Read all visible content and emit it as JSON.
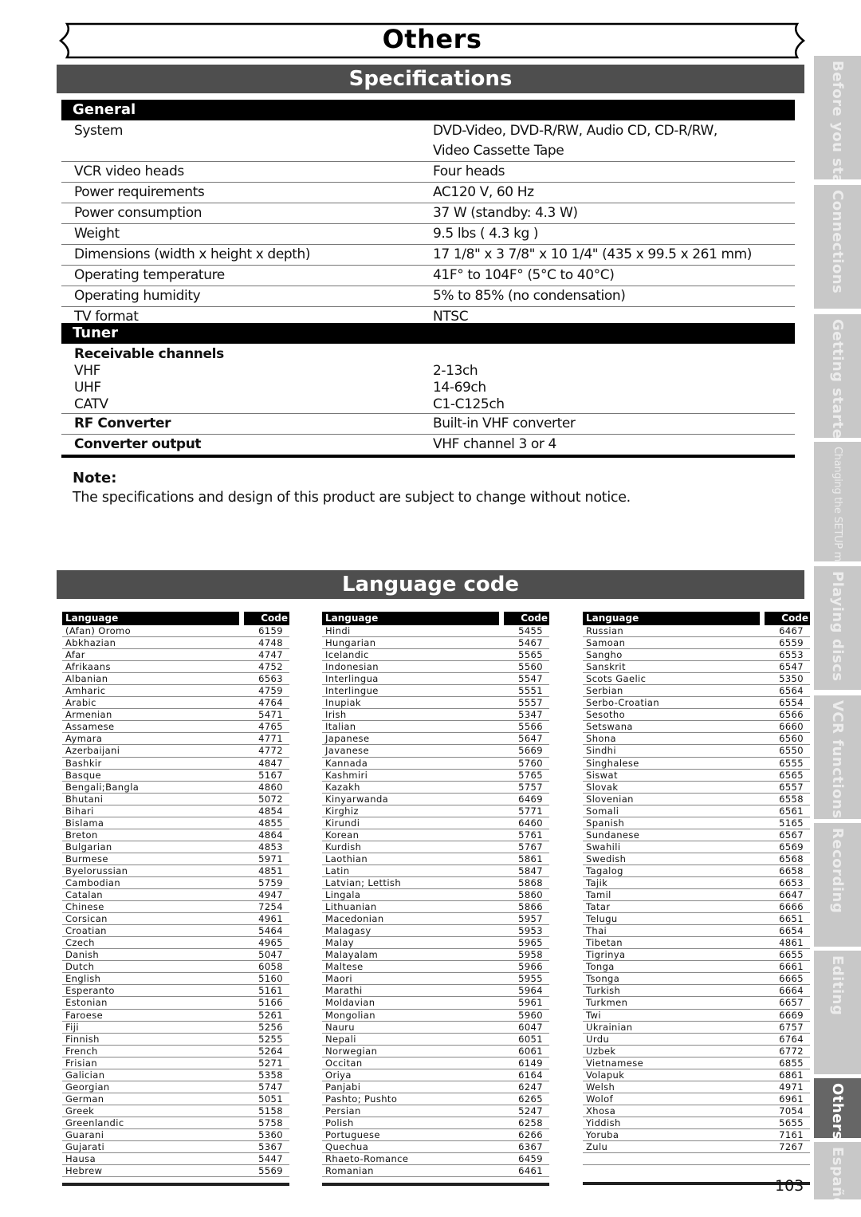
{
  "header": {
    "title": "Others"
  },
  "specifications": {
    "title": "Specifications",
    "general": {
      "title": "General",
      "rows": [
        {
          "label": "System",
          "value": "DVD-Video, DVD-R/RW,  Audio CD, CD-R/RW,",
          "value2": "Video Cassette Tape"
        },
        {
          "label": "VCR video heads",
          "value": "Four heads"
        },
        {
          "label": "Power requirements",
          "value": "AC120 V, 60 Hz"
        },
        {
          "label": "Power consumption",
          "value": "37 W (standby: 4.3 W)"
        },
        {
          "label": "Weight",
          "value": "9.5 lbs ( 4.3 kg )"
        },
        {
          "label": "Dimensions (width x height x depth)",
          "value": "17 1/8\" x 3 7/8\" x 10 1/4\" (435 x 99.5 x 261 mm)"
        },
        {
          "label": "Operating temperature",
          "value": "41F° to 104F° (5°C to 40°C)"
        },
        {
          "label": "Operating humidity",
          "value": "5% to 85% (no condensation)"
        },
        {
          "label": "TV format",
          "value": "NTSC"
        }
      ]
    },
    "tuner": {
      "title": "Tuner",
      "receivable_label": "Receivable channels",
      "channels": [
        {
          "label": "VHF",
          "value": "2-13ch"
        },
        {
          "label": "UHF",
          "value": "14-69ch"
        },
        {
          "label": "CATV",
          "value": "C1-C125ch"
        }
      ],
      "rf_converter": {
        "label": "RF Converter",
        "value": "Built-in VHF converter"
      },
      "converter_output": {
        "label": "Converter output",
        "value": "VHF channel 3 or 4"
      }
    },
    "note": {
      "label": "Note:",
      "text": "The specifications and design of this product are subject to change without notice."
    }
  },
  "language_code": {
    "title": "Language code",
    "header_language": "Language",
    "header_code": "Code",
    "columns": [
      [
        [
          "(Afan) Oromo",
          "6159"
        ],
        [
          "Abkhazian",
          "4748"
        ],
        [
          "Afar",
          "4747"
        ],
        [
          "Afrikaans",
          "4752"
        ],
        [
          "Albanian",
          "6563"
        ],
        [
          "Amharic",
          "4759"
        ],
        [
          "Arabic",
          "4764"
        ],
        [
          "Armenian",
          "5471"
        ],
        [
          "Assamese",
          "4765"
        ],
        [
          "Aymara",
          "4771"
        ],
        [
          "Azerbaijani",
          "4772"
        ],
        [
          "Bashkir",
          "4847"
        ],
        [
          "Basque",
          "5167"
        ],
        [
          "Bengali;Bangla",
          "4860"
        ],
        [
          "Bhutani",
          "5072"
        ],
        [
          "Bihari",
          "4854"
        ],
        [
          "Bislama",
          "4855"
        ],
        [
          "Breton",
          "4864"
        ],
        [
          "Bulgarian",
          "4853"
        ],
        [
          "Burmese",
          "5971"
        ],
        [
          "Byelorussian",
          "4851"
        ],
        [
          "Cambodian",
          "5759"
        ],
        [
          "Catalan",
          "4947"
        ],
        [
          "Chinese",
          "7254"
        ],
        [
          "Corsican",
          "4961"
        ],
        [
          "Croatian",
          "5464"
        ],
        [
          "Czech",
          "4965"
        ],
        [
          "Danish",
          "5047"
        ],
        [
          "Dutch",
          "6058"
        ],
        [
          "English",
          "5160"
        ],
        [
          "Esperanto",
          "5161"
        ],
        [
          "Estonian",
          "5166"
        ],
        [
          "Faroese",
          "5261"
        ],
        [
          "Fiji",
          "5256"
        ],
        [
          "Finnish",
          "5255"
        ],
        [
          "French",
          "5264"
        ],
        [
          "Frisian",
          "5271"
        ],
        [
          "Galician",
          "5358"
        ],
        [
          "Georgian",
          "5747"
        ],
        [
          "German",
          "5051"
        ],
        [
          "Greek",
          "5158"
        ],
        [
          "Greenlandic",
          "5758"
        ],
        [
          "Guarani",
          "5360"
        ],
        [
          "Gujarati",
          "5367"
        ],
        [
          "Hausa",
          "5447"
        ],
        [
          "Hebrew",
          "5569"
        ]
      ],
      [
        [
          "Hindi",
          "5455"
        ],
        [
          "Hungarian",
          "5467"
        ],
        [
          "Icelandic",
          "5565"
        ],
        [
          "Indonesian",
          "5560"
        ],
        [
          "Interlingua",
          "5547"
        ],
        [
          "Interlingue",
          "5551"
        ],
        [
          "Inupiak",
          "5557"
        ],
        [
          "Irish",
          "5347"
        ],
        [
          "Italian",
          "5566"
        ],
        [
          "Japanese",
          "5647"
        ],
        [
          "Javanese",
          "5669"
        ],
        [
          "Kannada",
          "5760"
        ],
        [
          "Kashmiri",
          "5765"
        ],
        [
          "Kazakh",
          "5757"
        ],
        [
          "Kinyarwanda",
          "6469"
        ],
        [
          "Kirghiz",
          "5771"
        ],
        [
          "Kirundi",
          "6460"
        ],
        [
          "Korean",
          "5761"
        ],
        [
          "Kurdish",
          "5767"
        ],
        [
          "Laothian",
          "5861"
        ],
        [
          "Latin",
          "5847"
        ],
        [
          "Latvian; Lettish",
          "5868"
        ],
        [
          "Lingala",
          "5860"
        ],
        [
          "Lithuanian",
          "5866"
        ],
        [
          "Macedonian",
          "5957"
        ],
        [
          "Malagasy",
          "5953"
        ],
        [
          "Malay",
          "5965"
        ],
        [
          "Malayalam",
          "5958"
        ],
        [
          "Maltese",
          "5966"
        ],
        [
          "Maori",
          "5955"
        ],
        [
          "Marathi",
          "5964"
        ],
        [
          "Moldavian",
          "5961"
        ],
        [
          "Mongolian",
          "5960"
        ],
        [
          "Nauru",
          "6047"
        ],
        [
          "Nepali",
          "6051"
        ],
        [
          "Norwegian",
          "6061"
        ],
        [
          "Occitan",
          "6149"
        ],
        [
          "Oriya",
          "6164"
        ],
        [
          "Panjabi",
          "6247"
        ],
        [
          "Pashto; Pushto",
          "6265"
        ],
        [
          "Persian",
          "5247"
        ],
        [
          "Polish",
          "6258"
        ],
        [
          "Portuguese",
          "6266"
        ],
        [
          "Quechua",
          "6367"
        ],
        [
          "Rhaeto-Romance",
          "6459"
        ],
        [
          "Romanian",
          "6461"
        ]
      ],
      [
        [
          "Russian",
          "6467"
        ],
        [
          "Samoan",
          "6559"
        ],
        [
          "Sangho",
          "6553"
        ],
        [
          "Sanskrit",
          "6547"
        ],
        [
          "Scots Gaelic",
          "5350"
        ],
        [
          "Serbian",
          "6564"
        ],
        [
          "Serbo-Croatian",
          "6554"
        ],
        [
          "Sesotho",
          "6566"
        ],
        [
          "Setswana",
          "6660"
        ],
        [
          "Shona",
          "6560"
        ],
        [
          "Sindhi",
          "6550"
        ],
        [
          "Singhalese",
          "6555"
        ],
        [
          "Siswat",
          "6565"
        ],
        [
          "Slovak",
          "6557"
        ],
        [
          "Slovenian",
          "6558"
        ],
        [
          "Somali",
          "6561"
        ],
        [
          "Spanish",
          "5165"
        ],
        [
          "Sundanese",
          "6567"
        ],
        [
          "Swahili",
          "6569"
        ],
        [
          "Swedish",
          "6568"
        ],
        [
          "Tagalog",
          "6658"
        ],
        [
          "Tajik",
          "6653"
        ],
        [
          "Tamil",
          "6647"
        ],
        [
          "Tatar",
          "6666"
        ],
        [
          "Telugu",
          "6651"
        ],
        [
          "Thai",
          "6654"
        ],
        [
          "Tibetan",
          "4861"
        ],
        [
          "Tigrinya",
          "6655"
        ],
        [
          "Tonga",
          "6661"
        ],
        [
          "Tsonga",
          "6665"
        ],
        [
          "Turkish",
          "6664"
        ],
        [
          "Turkmen",
          "6657"
        ],
        [
          "Twi",
          "6669"
        ],
        [
          "Ukrainian",
          "6757"
        ],
        [
          "Urdu",
          "6764"
        ],
        [
          "Uzbek",
          "6772"
        ],
        [
          "Vietnamese",
          "6855"
        ],
        [
          "Volapuk",
          "6861"
        ],
        [
          "Welsh",
          "4971"
        ],
        [
          "Wolof",
          "6961"
        ],
        [
          "Xhosa",
          "7054"
        ],
        [
          "Yiddish",
          "5655"
        ],
        [
          "Yoruba",
          "7161"
        ],
        [
          "Zulu",
          "7267"
        ]
      ]
    ]
  },
  "side_tabs": [
    {
      "label": "Before you start",
      "active": false
    },
    {
      "label": "Connections",
      "active": false
    },
    {
      "label": "Getting started",
      "active": false
    },
    {
      "label": "Changing the SETUP menu",
      "active": false,
      "condensed": true
    },
    {
      "label": "Playing discs",
      "active": false
    },
    {
      "label": "VCR functions",
      "active": false
    },
    {
      "label": "Recording",
      "active": false
    },
    {
      "label": "Editing",
      "active": false
    },
    {
      "label": "Others",
      "active": true
    },
    {
      "label": "Español",
      "active": false
    }
  ],
  "page_number": "103",
  "colors": {
    "section_bar": "#4e4e4e",
    "tab_inactive": "#c8c8c8",
    "tab_active": "#666666"
  }
}
